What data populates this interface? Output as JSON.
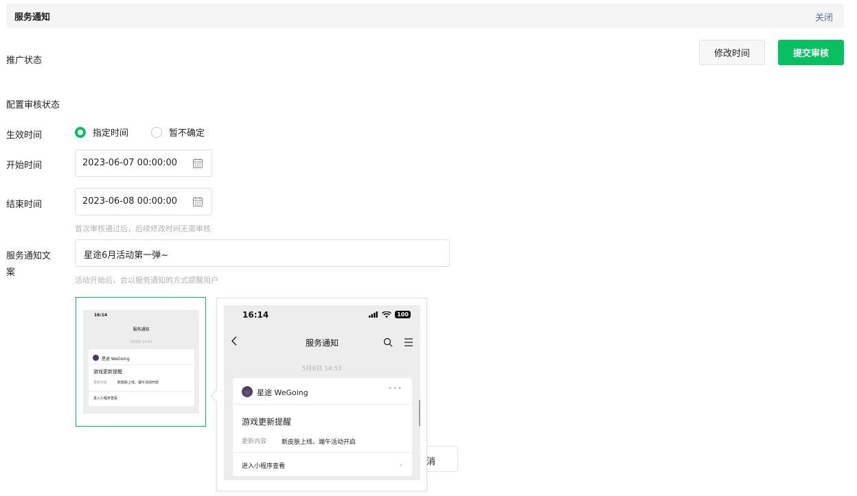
{
  "header": {
    "title": "服务通知",
    "close_label": "关闭"
  },
  "promotion": {
    "label": "推广状态",
    "modify_time_label": "修改时间",
    "submit_label": "提交审核"
  },
  "config": {
    "label": "配置审核状态"
  },
  "effective": {
    "label": "生效时间",
    "options": [
      {
        "label": "指定时间",
        "selected": true
      },
      {
        "label": "暂不确定",
        "selected": false
      }
    ]
  },
  "start": {
    "label": "开始时间",
    "value": "2023-06-07 00:00:00"
  },
  "end": {
    "label": "结束时间",
    "value": "2023-06-08 00:00:00",
    "hint": "首次审核通过后，后续修改时间无需审核"
  },
  "notice": {
    "label_line1": "服务通知文",
    "label_line2": "案",
    "value": "星途6月活动第一弹~",
    "hint": "活动开始后，会以服务通知的方式提醒用户"
  },
  "preview": {
    "status_time": "16:14",
    "battery": "100",
    "nav_title": "服务通知",
    "date": "5月8日 14:53",
    "account_name": "星途 WeGoing",
    "card_title": "游戏更新提醒",
    "field_key": "更新内容",
    "field_value": "新皮肤上线、端午活动开启",
    "enter_label": "进入小程序查看"
  },
  "cancel_partial_label": "消",
  "colors": {
    "primary": "#07c160",
    "link": "#576b95"
  }
}
